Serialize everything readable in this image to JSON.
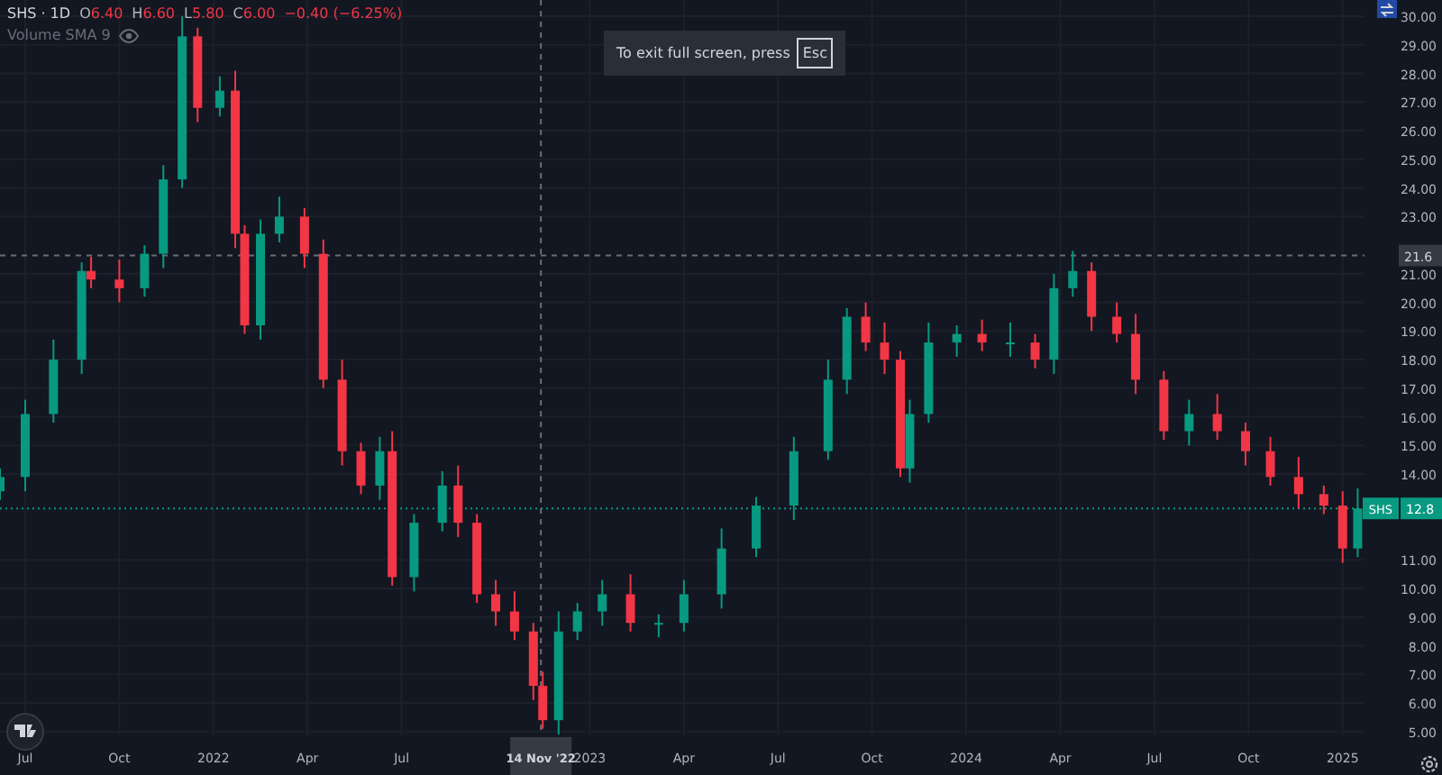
{
  "legend": {
    "symbol": "SHS · 1D",
    "ohlc": [
      {
        "label": "O",
        "value": "6.40"
      },
      {
        "label": "H",
        "value": "6.60"
      },
      {
        "label": "L",
        "value": "5.80"
      },
      {
        "label": "C",
        "value": "6.00"
      }
    ],
    "change": "−0.40 (−6.25%)",
    "indicator": "Volume SMA 9"
  },
  "toast": {
    "message": "To exit full screen, press",
    "key": "Esc"
  },
  "crosshair": {
    "time_label": "14 Nov '22",
    "price_label": "21.6"
  },
  "last_price": {
    "symbol": "SHS",
    "price": "12.8"
  },
  "chart_data": {
    "type": "candlestick",
    "x": [
      2021.433,
      2021.5,
      2021.575,
      2021.65,
      2021.675,
      2021.75,
      2021.817,
      2021.867,
      2021.917,
      2021.958,
      2022.017,
      2022.058,
      2022.083,
      2022.125,
      2022.175,
      2022.242,
      2022.292,
      2022.342,
      2022.392,
      2022.442,
      2022.475,
      2022.533,
      2022.608,
      2022.65,
      2022.7,
      2022.75,
      2022.8,
      2022.85,
      2022.875,
      2022.917,
      2022.967,
      2023.033,
      2023.108,
      2023.183,
      2023.25,
      2023.35,
      2023.442,
      2023.542,
      2023.633,
      2023.683,
      2023.733,
      2023.783,
      2023.825,
      2023.85,
      2023.9,
      2023.975,
      2024.042,
      2024.117,
      2024.183,
      2024.233,
      2024.283,
      2024.333,
      2024.4,
      2024.45,
      2024.525,
      2024.592,
      2024.667,
      2024.742,
      2024.808,
      2024.883,
      2024.95,
      2025.0,
      2025.04
    ],
    "ohlc": [
      [
        13.4,
        14.2,
        13.1,
        13.9
      ],
      [
        13.9,
        16.6,
        13.4,
        16.1
      ],
      [
        16.1,
        18.7,
        15.8,
        18
      ],
      [
        18,
        21.4,
        17.5,
        21.1
      ],
      [
        21.1,
        21.6,
        20.5,
        20.8
      ],
      [
        20.8,
        21.5,
        20.0,
        20.5
      ],
      [
        20.5,
        22.0,
        20.2,
        21.7
      ],
      [
        21.7,
        24.8,
        21.2,
        24.3
      ],
      [
        24.3,
        30.0,
        24.0,
        29.3
      ],
      [
        29.3,
        29.6,
        26.3,
        26.8
      ],
      [
        26.8,
        27.9,
        26.5,
        27.4
      ],
      [
        27.4,
        28.1,
        21.9,
        22.4
      ],
      [
        22.4,
        22.7,
        18.9,
        19.2
      ],
      [
        19.2,
        22.9,
        18.7,
        22.4
      ],
      [
        22.4,
        23.7,
        22.1,
        23
      ],
      [
        23,
        23.3,
        21.2,
        21.7
      ],
      [
        21.7,
        22.2,
        17.0,
        17.3
      ],
      [
        17.3,
        18.0,
        14.3,
        14.8
      ],
      [
        14.8,
        15.1,
        13.3,
        13.6
      ],
      [
        13.6,
        15.3,
        13.1,
        14.8
      ],
      [
        14.8,
        15.5,
        10.1,
        10.4
      ],
      [
        10.4,
        12.6,
        9.9,
        12.3
      ],
      [
        12.3,
        14.1,
        12.0,
        13.6
      ],
      [
        13.6,
        14.3,
        11.8,
        12.3
      ],
      [
        12.3,
        12.6,
        9.5,
        9.8
      ],
      [
        9.8,
        10.3,
        8.7,
        9.2
      ],
      [
        9.2,
        9.9,
        8.2,
        8.5
      ],
      [
        8.5,
        8.8,
        6.1,
        6.6
      ],
      [
        6.6,
        7.1,
        5.1,
        5.4
      ],
      [
        5.4,
        9.2,
        4.9,
        8.5
      ],
      [
        8.5,
        9.5,
        8.2,
        9.2
      ],
      [
        9.2,
        10.3,
        8.7,
        9.8
      ],
      [
        9.8,
        10.5,
        8.5,
        8.8
      ],
      [
        8.8,
        9.1,
        8.3,
        8.8
      ],
      [
        8.8,
        10.3,
        8.5,
        9.8
      ],
      [
        9.8,
        12.1,
        9.3,
        11.4
      ],
      [
        11.4,
        13.2,
        11.1,
        12.9
      ],
      [
        12.9,
        15.3,
        12.4,
        14.8
      ],
      [
        14.8,
        18.0,
        14.5,
        17.3
      ],
      [
        17.3,
        19.8,
        16.8,
        19.5
      ],
      [
        19.5,
        20.0,
        18.3,
        18.6
      ],
      [
        18.6,
        19.3,
        17.5,
        18
      ],
      [
        18,
        18.3,
        13.9,
        14.2
      ],
      [
        14.2,
        16.6,
        13.7,
        16.1
      ],
      [
        16.1,
        19.3,
        15.8,
        18.6
      ],
      [
        18.6,
        19.2,
        18.1,
        18.9
      ],
      [
        18.9,
        19.4,
        18.3,
        18.6
      ],
      [
        18.6,
        19.3,
        18.1,
        18.6
      ],
      [
        18.6,
        18.9,
        17.7,
        18
      ],
      [
        18,
        21.0,
        17.5,
        20.5
      ],
      [
        20.5,
        21.8,
        20.2,
        21.1
      ],
      [
        21.1,
        21.4,
        19.0,
        19.5
      ],
      [
        19.5,
        20.0,
        18.6,
        18.9
      ],
      [
        18.9,
        19.6,
        16.8,
        17.3
      ],
      [
        17.3,
        17.6,
        15.2,
        15.5
      ],
      [
        15.5,
        16.6,
        15.0,
        16.1
      ],
      [
        16.1,
        16.8,
        15.2,
        15.5
      ],
      [
        15.5,
        15.8,
        14.3,
        14.8
      ],
      [
        14.8,
        15.3,
        13.6,
        13.9
      ],
      [
        13.9,
        14.6,
        12.8,
        13.3
      ],
      [
        13.3,
        13.6,
        12.6,
        12.9
      ],
      [
        12.9,
        13.4,
        10.9,
        11.4
      ],
      [
        11.4,
        13.5,
        11.1,
        12.8
      ]
    ],
    "xlim": [
      2021.433,
      2025.264
    ],
    "ylim": [
      3.484,
      30.57
    ],
    "grid": true,
    "ref_lines": [
      {
        "axis": "x",
        "value": 2022.87,
        "color": "#6a6d78"
      },
      {
        "axis": "y",
        "value": 21.64,
        "color": "#6a6d78"
      },
      {
        "axis": "y",
        "value": 12.8,
        "color": "#089981"
      }
    ],
    "xticks": [
      {
        "value": 2021.5,
        "label": "Jul"
      },
      {
        "value": 2021.75,
        "label": "Oct"
      },
      {
        "value": 2022,
        "label": "2022"
      },
      {
        "value": 2022.25,
        "label": "Apr"
      },
      {
        "value": 2022.5,
        "label": "Jul"
      },
      {
        "value": 2023,
        "label": "2023"
      },
      {
        "value": 2023.25,
        "label": "Apr"
      },
      {
        "value": 2023.5,
        "label": "Jul"
      },
      {
        "value": 2023.75,
        "label": "Oct"
      },
      {
        "value": 2024,
        "label": "2024"
      },
      {
        "value": 2024.25,
        "label": "Apr"
      },
      {
        "value": 2024.5,
        "label": "Jul"
      },
      {
        "value": 2024.75,
        "label": "Oct"
      },
      {
        "value": 2025,
        "label": "2025"
      }
    ],
    "yticks": [
      {
        "value": 5,
        "label": "5.00"
      },
      {
        "value": 6,
        "label": "6.00"
      },
      {
        "value": 7,
        "label": "7.00"
      },
      {
        "value": 8,
        "label": "8.00"
      },
      {
        "value": 9,
        "label": "9.00"
      },
      {
        "value": 10,
        "label": "10.00"
      },
      {
        "value": 11,
        "label": "11.00"
      },
      {
        "value": 14,
        "label": "14.00"
      },
      {
        "value": 15,
        "label": "15.00"
      },
      {
        "value": 16,
        "label": "16.00"
      },
      {
        "value": 17,
        "label": "17.00"
      },
      {
        "value": 18,
        "label": "18.00"
      },
      {
        "value": 19,
        "label": "19.00"
      },
      {
        "value": 20,
        "label": "20.00"
      },
      {
        "value": 21,
        "label": "21.00"
      },
      {
        "value": 23,
        "label": "23.00"
      },
      {
        "value": 24,
        "label": "24.00"
      },
      {
        "value": 25,
        "label": "25.00"
      },
      {
        "value": 26,
        "label": "26.00"
      },
      {
        "value": 27,
        "label": "27.00"
      },
      {
        "value": 28,
        "label": "28.00"
      },
      {
        "value": 29,
        "label": "29.00"
      },
      {
        "value": 30,
        "label": "30.00"
      }
    ]
  }
}
